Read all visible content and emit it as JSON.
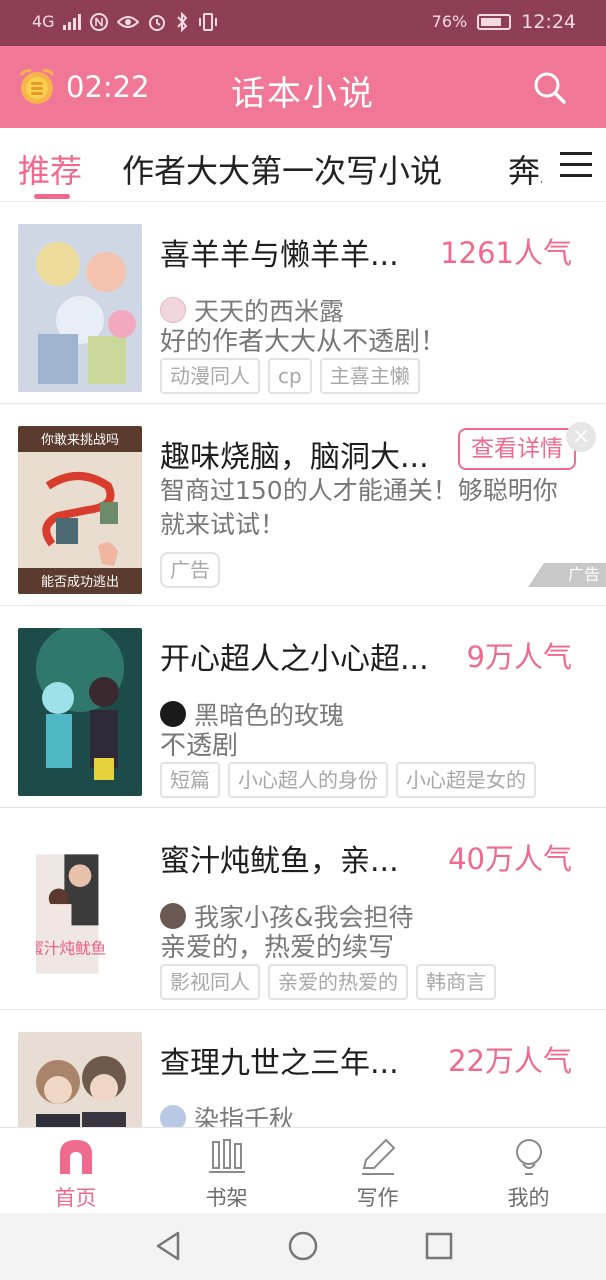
{
  "status_bar": {
    "signal_text": "4G",
    "battery_percent": "76%",
    "battery_level": 0.76,
    "time": "12:24"
  },
  "app_bar": {
    "timer": "02:22",
    "title": "话本小说",
    "icons": {
      "left": "alarm-clock-icon",
      "right": "search-icon"
    }
  },
  "tabs": {
    "items": [
      "推荐",
      "作者大大第一次写小说",
      "奔跑"
    ],
    "active_index": 0,
    "accent_color": "#ef6a8e"
  },
  "stories": [
    {
      "title": "喜羊羊与懒羊羊...",
      "popularity": "1261人气",
      "author": "天天的西米露",
      "description": "好的作者大大从不透剧！",
      "tags": [
        "动漫同人",
        "cp",
        "主喜主懒"
      ]
    },
    {
      "title": "开心超人之小心超...",
      "popularity": "9万人气",
      "author": "黑暗色的玫瑰",
      "description": "不透剧",
      "tags": [
        "短篇",
        "小心超人的身份",
        "小心超是女的"
      ]
    },
    {
      "title": "蜜汁炖鱿鱼，亲...",
      "popularity": "40万人气",
      "author": "我家小孩&我会担待",
      "description": "亲爱的，热爱的续写",
      "tags": [
        "影视同人",
        "亲爱的热爱的",
        "韩商言"
      ]
    },
    {
      "title": "查理九世之三年...",
      "popularity": "22万人气",
      "author": "染指千秋",
      "description": "",
      "tags": []
    }
  ],
  "ad": {
    "title": "趣味烧脑，脑洞大...",
    "button_label": "查看详情",
    "description": "智商过150的人才能通关！够聪明你就来试试！",
    "chip": "广告",
    "badge": "广告",
    "cover_text_top": "你敢来挑战吗",
    "cover_text_bottom": "能否成功逃出"
  },
  "covers": {
    "story_3_text": "蜜汁炖鱿鱼"
  },
  "bottom_nav": {
    "items": [
      "首页",
      "书架",
      "写作",
      "我的"
    ],
    "active_index": 0
  },
  "system_nav": [
    "back-icon",
    "home-icon",
    "recents-icon"
  ],
  "colors": {
    "status_bar": "#8f3f54",
    "app_bar": "#f07896",
    "accent": "#ef6a8e"
  }
}
